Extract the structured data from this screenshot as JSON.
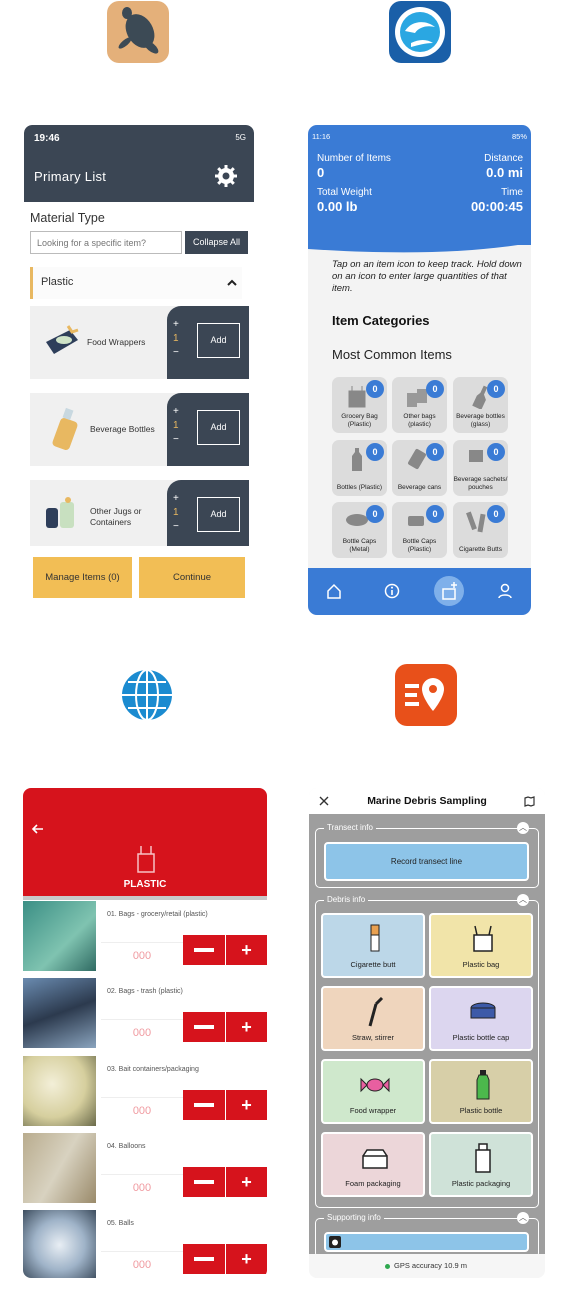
{
  "app1": {
    "status_time": "19:46",
    "status_net": "5G",
    "title": "Primary List",
    "material_type": "Material Type",
    "search_placeholder": "Looking for a specific item?",
    "collapse_label": "Collapse All",
    "category": "Plastic",
    "items": [
      {
        "label": "Food Wrappers",
        "plus": "+",
        "count": "1",
        "minus": "−",
        "add": "Add"
      },
      {
        "label": "Beverage Bottles",
        "plus": "+",
        "count": "1",
        "minus": "−",
        "add": "Add"
      },
      {
        "label": "Other Jugs or Containers",
        "plus": "+",
        "count": "1",
        "minus": "−",
        "add": "Add"
      }
    ],
    "manage_label": "Manage Items (0)",
    "continue_label": "Continue"
  },
  "app2": {
    "status_time": "11:16",
    "status_battery": "85%",
    "num_items_label": "Number of Items",
    "num_items": "0",
    "distance_label": "Distance",
    "distance": "0.0 mi",
    "weight_label": "Total Weight",
    "weight": "0.00 lb",
    "time_label": "Time",
    "time": "00:00:45",
    "tip": "Tap on an item icon to keep track. Hold down on an icon to enter large quantities of that item.",
    "categories_title": "Item Categories",
    "common_title": "Most Common Items",
    "tiles": [
      {
        "label": "Grocery Bag (Plastic)",
        "count": "0"
      },
      {
        "label": "Other bags (plastic)",
        "count": "0"
      },
      {
        "label": "Beverage bottles (glass)",
        "count": "0"
      },
      {
        "label": "Bottles (Plastic)",
        "count": "0"
      },
      {
        "label": "Beverage cans",
        "count": "0"
      },
      {
        "label": "Beverage sachets/ pouches",
        "count": "0"
      },
      {
        "label": "Bottle Caps (Metal)",
        "count": "0"
      },
      {
        "label": "Bottle Caps (Plastic)",
        "count": "0"
      },
      {
        "label": "Cigarette Butts",
        "count": "0"
      }
    ]
  },
  "app3": {
    "category": "PLASTIC",
    "rows": [
      {
        "label": "01. Bags - grocery/retail (plastic)",
        "value": "000"
      },
      {
        "label": "02. Bags - trash (plastic)",
        "value": "000"
      },
      {
        "label": "03. Bait containers/packaging",
        "value": "000"
      },
      {
        "label": "04. Balloons",
        "value": "000"
      },
      {
        "label": "05. Balls",
        "value": "000"
      }
    ],
    "plus": "+"
  },
  "app4": {
    "title": "Marine Debris Sampling",
    "transect_header": "Transect info",
    "record_label": "Record transect line",
    "debris_header": "Debris info",
    "debris": [
      {
        "label": "Cigarette butt"
      },
      {
        "label": "Plastic bag"
      },
      {
        "label": "Straw, stirrer"
      },
      {
        "label": "Plastic bottle cap"
      },
      {
        "label": "Food wrapper"
      },
      {
        "label": "Plastic bottle"
      },
      {
        "label": "Foam packaging"
      },
      {
        "label": "Plastic packaging"
      }
    ],
    "supporting_header": "Supporting info",
    "gps": "GPS accuracy 10.9 m"
  },
  "colors": {
    "dark": "#3b4654",
    "gold": "#f2be55",
    "blue": "#3a7bd5",
    "red": "#d6131c"
  }
}
